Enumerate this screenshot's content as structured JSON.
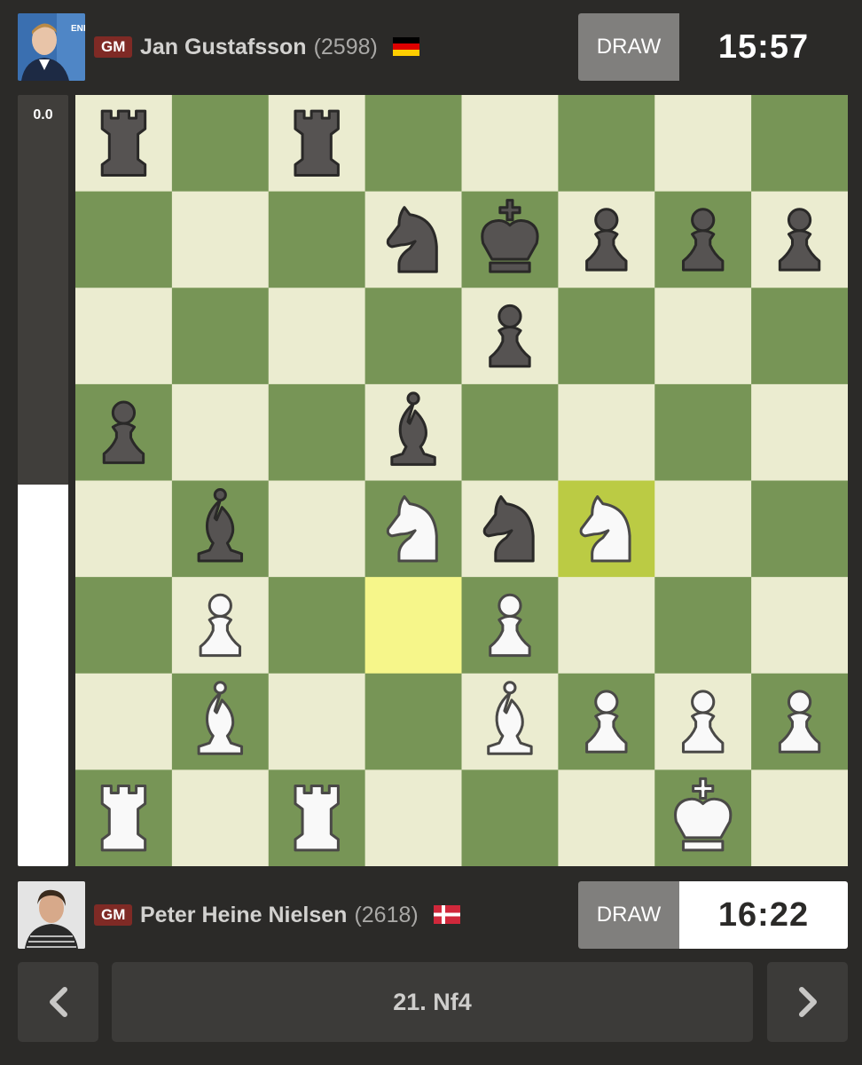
{
  "top_player": {
    "title": "GM",
    "name": "Jan Gustafsson",
    "rating": "(2598)",
    "flag": "flag-germany-icon",
    "draw_label": "DRAW",
    "clock": "15:57",
    "avatar_text": "ENKE GR"
  },
  "bottom_player": {
    "title": "GM",
    "name": "Peter Heine Nielsen",
    "rating": "(2618)",
    "flag": "flag-denmark-icon",
    "draw_label": "DRAW",
    "clock": "16:22"
  },
  "eval": {
    "label": "0.0",
    "white_fraction": 0.495
  },
  "board": {
    "colors": {
      "light": "#ebecd0",
      "dark": "#779556",
      "last_move_from": "#f6f68a",
      "last_move_to": "#bbcb44"
    },
    "last_move": {
      "from": "d3",
      "to": "f4"
    },
    "pieces": [
      {
        "square": "a8",
        "piece": "bR"
      },
      {
        "square": "c8",
        "piece": "bR"
      },
      {
        "square": "d7",
        "piece": "bN"
      },
      {
        "square": "e7",
        "piece": "bK"
      },
      {
        "square": "f7",
        "piece": "bP"
      },
      {
        "square": "g7",
        "piece": "bP"
      },
      {
        "square": "h7",
        "piece": "bP"
      },
      {
        "square": "e6",
        "piece": "bP"
      },
      {
        "square": "a5",
        "piece": "bP"
      },
      {
        "square": "d5",
        "piece": "bB"
      },
      {
        "square": "b4",
        "piece": "bB"
      },
      {
        "square": "d4",
        "piece": "wN"
      },
      {
        "square": "e4",
        "piece": "bN"
      },
      {
        "square": "f4",
        "piece": "wN"
      },
      {
        "square": "b3",
        "piece": "wP"
      },
      {
        "square": "e3",
        "piece": "wP"
      },
      {
        "square": "b2",
        "piece": "wB"
      },
      {
        "square": "e2",
        "piece": "wB"
      },
      {
        "square": "f2",
        "piece": "wP"
      },
      {
        "square": "g2",
        "piece": "wP"
      },
      {
        "square": "h2",
        "piece": "wP"
      },
      {
        "square": "a1",
        "piece": "wR"
      },
      {
        "square": "c1",
        "piece": "wR"
      },
      {
        "square": "g1",
        "piece": "wK"
      }
    ]
  },
  "nav": {
    "prev_icon": "chevron-left-icon",
    "move": "21. Nf4",
    "next_icon": "chevron-right-icon"
  }
}
